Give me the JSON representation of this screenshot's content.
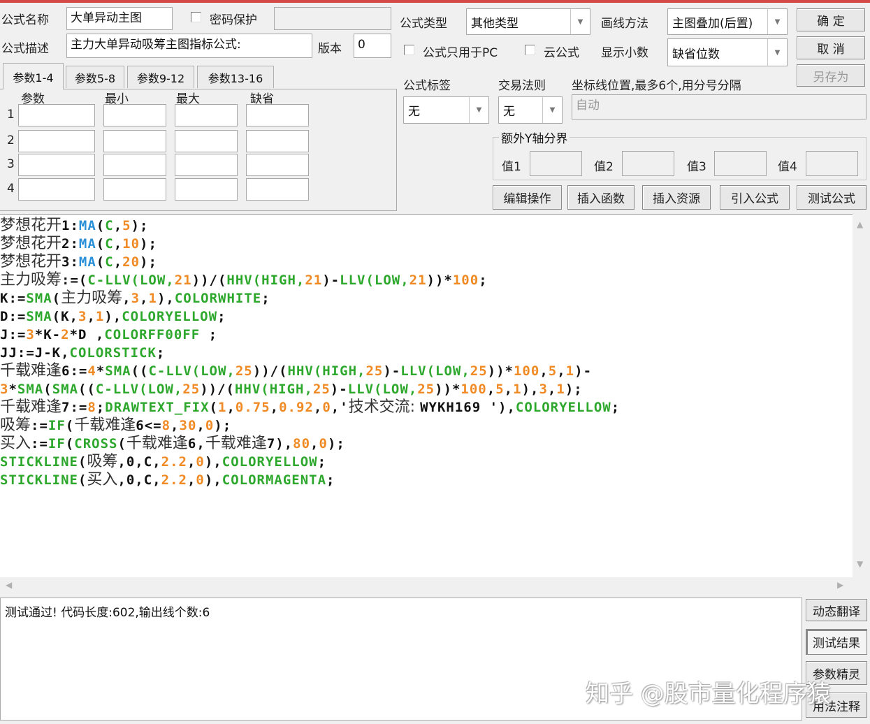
{
  "form": {
    "name_label": "公式名称",
    "name_value": "大单异动主图",
    "password_label": "密码保护",
    "password_value": "",
    "desc_label": "公式描述",
    "desc_value": "主力大单异动吸筹主图指标公式:",
    "version_label": "版本",
    "version_value": "0",
    "type_label": "公式类型",
    "type_value": "其他类型",
    "draw_label": "画线方法",
    "draw_value": "主图叠加(后置)",
    "pc_only_label": "公式只用于PC",
    "cloud_label": "云公式",
    "decimal_label": "显示小数",
    "decimal_value": "缺省位数",
    "tag_label": "公式标签",
    "tag_value": "无",
    "rule_label": "交易法则",
    "rule_value": "无",
    "axis_label": "坐标线位置,最多6个,用分号分隔",
    "axis_value": "自动",
    "yaxis_legend": "额外Y轴分界",
    "yvals": [
      "值1",
      "值2",
      "值3",
      "值4"
    ]
  },
  "buttons": {
    "ok": "确  定",
    "cancel": "取  消",
    "save_as": "另存为",
    "actions": [
      "编辑操作",
      "插入函数",
      "插入资源",
      "引入公式",
      "测试公式"
    ],
    "side": [
      "动态翻译",
      "测试结果",
      "参数精灵",
      "用法注释"
    ]
  },
  "params": {
    "tabs": [
      "参数1-4",
      "参数5-8",
      "参数9-12",
      "参数13-16"
    ],
    "headers": [
      "参数",
      "最小",
      "最大",
      "缺省"
    ],
    "rows": [
      "1",
      "2",
      "3",
      "4"
    ]
  },
  "code": [
    [
      [
        "c",
        "梦想花开"
      ],
      [
        "t",
        "1:"
      ],
      [
        "b",
        "MA"
      ],
      [
        "t",
        "("
      ],
      [
        "g",
        "C"
      ],
      [
        "t",
        ","
      ],
      [
        "n",
        "5"
      ],
      [
        "t",
        ");"
      ]
    ],
    [
      [
        "c",
        "梦想花开"
      ],
      [
        "t",
        "2:"
      ],
      [
        "b",
        "MA"
      ],
      [
        "t",
        "("
      ],
      [
        "g",
        "C"
      ],
      [
        "t",
        ","
      ],
      [
        "n",
        "10"
      ],
      [
        "t",
        ");"
      ]
    ],
    [
      [
        "c",
        "梦想花开"
      ],
      [
        "t",
        "3:"
      ],
      [
        "b",
        "MA"
      ],
      [
        "t",
        "("
      ],
      [
        "g",
        "C"
      ],
      [
        "t",
        ","
      ],
      [
        "n",
        "20"
      ],
      [
        "t",
        ");"
      ]
    ],
    [
      [
        "c",
        "主力吸筹"
      ],
      [
        "t",
        ":=("
      ],
      [
        "g",
        "C-LLV(LOW,"
      ],
      [
        "n",
        "21"
      ],
      [
        "t",
        "))/("
      ],
      [
        "g",
        "HHV(HIGH,"
      ],
      [
        "n",
        "21"
      ],
      [
        "t",
        ")-"
      ],
      [
        "g",
        "LLV(LOW,"
      ],
      [
        "n",
        "21"
      ],
      [
        "t",
        "))*"
      ],
      [
        "n",
        "100"
      ],
      [
        "t",
        ";"
      ]
    ],
    [
      [
        "t",
        "K:="
      ],
      [
        "g",
        "SMA"
      ],
      [
        "t",
        "("
      ],
      [
        "c",
        "主力吸筹"
      ],
      [
        "t",
        ","
      ],
      [
        "n",
        "3"
      ],
      [
        "t",
        ","
      ],
      [
        "n",
        "1"
      ],
      [
        "t",
        "),"
      ],
      [
        "g",
        "COLORWHITE"
      ],
      [
        "t",
        ";"
      ]
    ],
    [
      [
        "t",
        "D:="
      ],
      [
        "g",
        "SMA"
      ],
      [
        "t",
        "(K,"
      ],
      [
        "n",
        "3"
      ],
      [
        "t",
        ","
      ],
      [
        "n",
        "1"
      ],
      [
        "t",
        "),"
      ],
      [
        "g",
        "COLORYELLOW"
      ],
      [
        "t",
        ";"
      ]
    ],
    [
      [
        "t",
        "J:="
      ],
      [
        "n",
        "3"
      ],
      [
        "t",
        "*K-"
      ],
      [
        "n",
        "2"
      ],
      [
        "t",
        "*D ,"
      ],
      [
        "g",
        "COLORFF00FF"
      ],
      [
        "t",
        " ;"
      ]
    ],
    [
      [
        "t",
        "JJ:=J-K,"
      ],
      [
        "g",
        "COLORSTICK"
      ],
      [
        "t",
        ";"
      ]
    ],
    [
      [
        "c",
        "千载难逢"
      ],
      [
        "t",
        "6:="
      ],
      [
        "n",
        "4"
      ],
      [
        "t",
        "*"
      ],
      [
        "g",
        "SMA"
      ],
      [
        "t",
        "(("
      ],
      [
        "g",
        "C-LLV(LOW,"
      ],
      [
        "n",
        "25"
      ],
      [
        "t",
        "))/("
      ],
      [
        "g",
        "HHV(HIGH,"
      ],
      [
        "n",
        "25"
      ],
      [
        "t",
        ")-"
      ],
      [
        "g",
        "LLV(LOW,"
      ],
      [
        "n",
        "25"
      ],
      [
        "t",
        "))*"
      ],
      [
        "n",
        "100"
      ],
      [
        "t",
        ","
      ],
      [
        "n",
        "5"
      ],
      [
        "t",
        ","
      ],
      [
        "n",
        "1"
      ],
      [
        "t",
        ")-"
      ]
    ],
    [
      [
        "n",
        "3"
      ],
      [
        "t",
        "*"
      ],
      [
        "g",
        "SMA"
      ],
      [
        "t",
        "("
      ],
      [
        "g",
        "SMA"
      ],
      [
        "t",
        "(("
      ],
      [
        "g",
        "C-LLV(LOW,"
      ],
      [
        "n",
        "25"
      ],
      [
        "t",
        "))/("
      ],
      [
        "g",
        "HHV(HIGH,"
      ],
      [
        "n",
        "25"
      ],
      [
        "t",
        ")-"
      ],
      [
        "g",
        "LLV(LOW,"
      ],
      [
        "n",
        "25"
      ],
      [
        "t",
        "))*"
      ],
      [
        "n",
        "100"
      ],
      [
        "t",
        ","
      ],
      [
        "n",
        "5"
      ],
      [
        "t",
        ","
      ],
      [
        "n",
        "1"
      ],
      [
        "t",
        "),"
      ],
      [
        "n",
        "3"
      ],
      [
        "t",
        ","
      ],
      [
        "n",
        "1"
      ],
      [
        "t",
        ");"
      ]
    ],
    [
      [
        "c",
        "千载难逢"
      ],
      [
        "t",
        "7:="
      ],
      [
        "n",
        "8"
      ],
      [
        "t",
        ";"
      ],
      [
        "g",
        "DRAWTEXT_FIX"
      ],
      [
        "t",
        "("
      ],
      [
        "n",
        "1"
      ],
      [
        "t",
        ","
      ],
      [
        "n",
        "0.75"
      ],
      [
        "t",
        ","
      ],
      [
        "n",
        "0.92"
      ],
      [
        "t",
        ","
      ],
      [
        "n",
        "0"
      ],
      [
        "t",
        ",'"
      ],
      [
        "c",
        "技术交流: "
      ],
      [
        "t",
        "WYKH169 '),"
      ],
      [
        "g",
        "COLORYELLOW"
      ],
      [
        "t",
        ";"
      ]
    ],
    [
      [
        "c",
        "吸筹"
      ],
      [
        "t",
        ":="
      ],
      [
        "g",
        "IF"
      ],
      [
        "t",
        "("
      ],
      [
        "c",
        "千载难逢"
      ],
      [
        "t",
        "6<="
      ],
      [
        "n",
        "8"
      ],
      [
        "t",
        ","
      ],
      [
        "n",
        "30"
      ],
      [
        "t",
        ","
      ],
      [
        "n",
        "0"
      ],
      [
        "t",
        ");"
      ]
    ],
    [
      [
        "c",
        "买入"
      ],
      [
        "t",
        ":="
      ],
      [
        "g",
        "IF"
      ],
      [
        "t",
        "("
      ],
      [
        "g",
        "CROSS"
      ],
      [
        "t",
        "("
      ],
      [
        "c",
        "千载难逢"
      ],
      [
        "t",
        "6,"
      ],
      [
        "c",
        "千载难逢"
      ],
      [
        "t",
        "7),"
      ],
      [
        "n",
        "80"
      ],
      [
        "t",
        ","
      ],
      [
        "n",
        "0"
      ],
      [
        "t",
        ");"
      ]
    ],
    [
      [
        "g",
        "STICKLINE"
      ],
      [
        "t",
        "("
      ],
      [
        "c",
        "吸筹"
      ],
      [
        "t",
        ",0,C,"
      ],
      [
        "n",
        "2.2"
      ],
      [
        "t",
        ","
      ],
      [
        "n",
        "0"
      ],
      [
        "t",
        "),"
      ],
      [
        "g",
        "COLORYELLOW"
      ],
      [
        "t",
        ";"
      ]
    ],
    [
      [
        "g",
        "STICKLINE"
      ],
      [
        "t",
        "("
      ],
      [
        "c",
        "买入"
      ],
      [
        "t",
        ",0,C,"
      ],
      [
        "n",
        "2.2"
      ],
      [
        "t",
        ","
      ],
      [
        "n",
        "0"
      ],
      [
        "t",
        "),"
      ],
      [
        "g",
        "COLORMAGENTA"
      ],
      [
        "t",
        ";"
      ]
    ]
  ],
  "output": {
    "text": "测试通过! 代码长度:602,输出线个数:6"
  },
  "watermark": "知乎 @股市量化程序猿",
  "colors": {
    "function": "#2da82d",
    "ma": "#2a90d8",
    "number": "#f08a24",
    "title_bar": "#d44848"
  }
}
